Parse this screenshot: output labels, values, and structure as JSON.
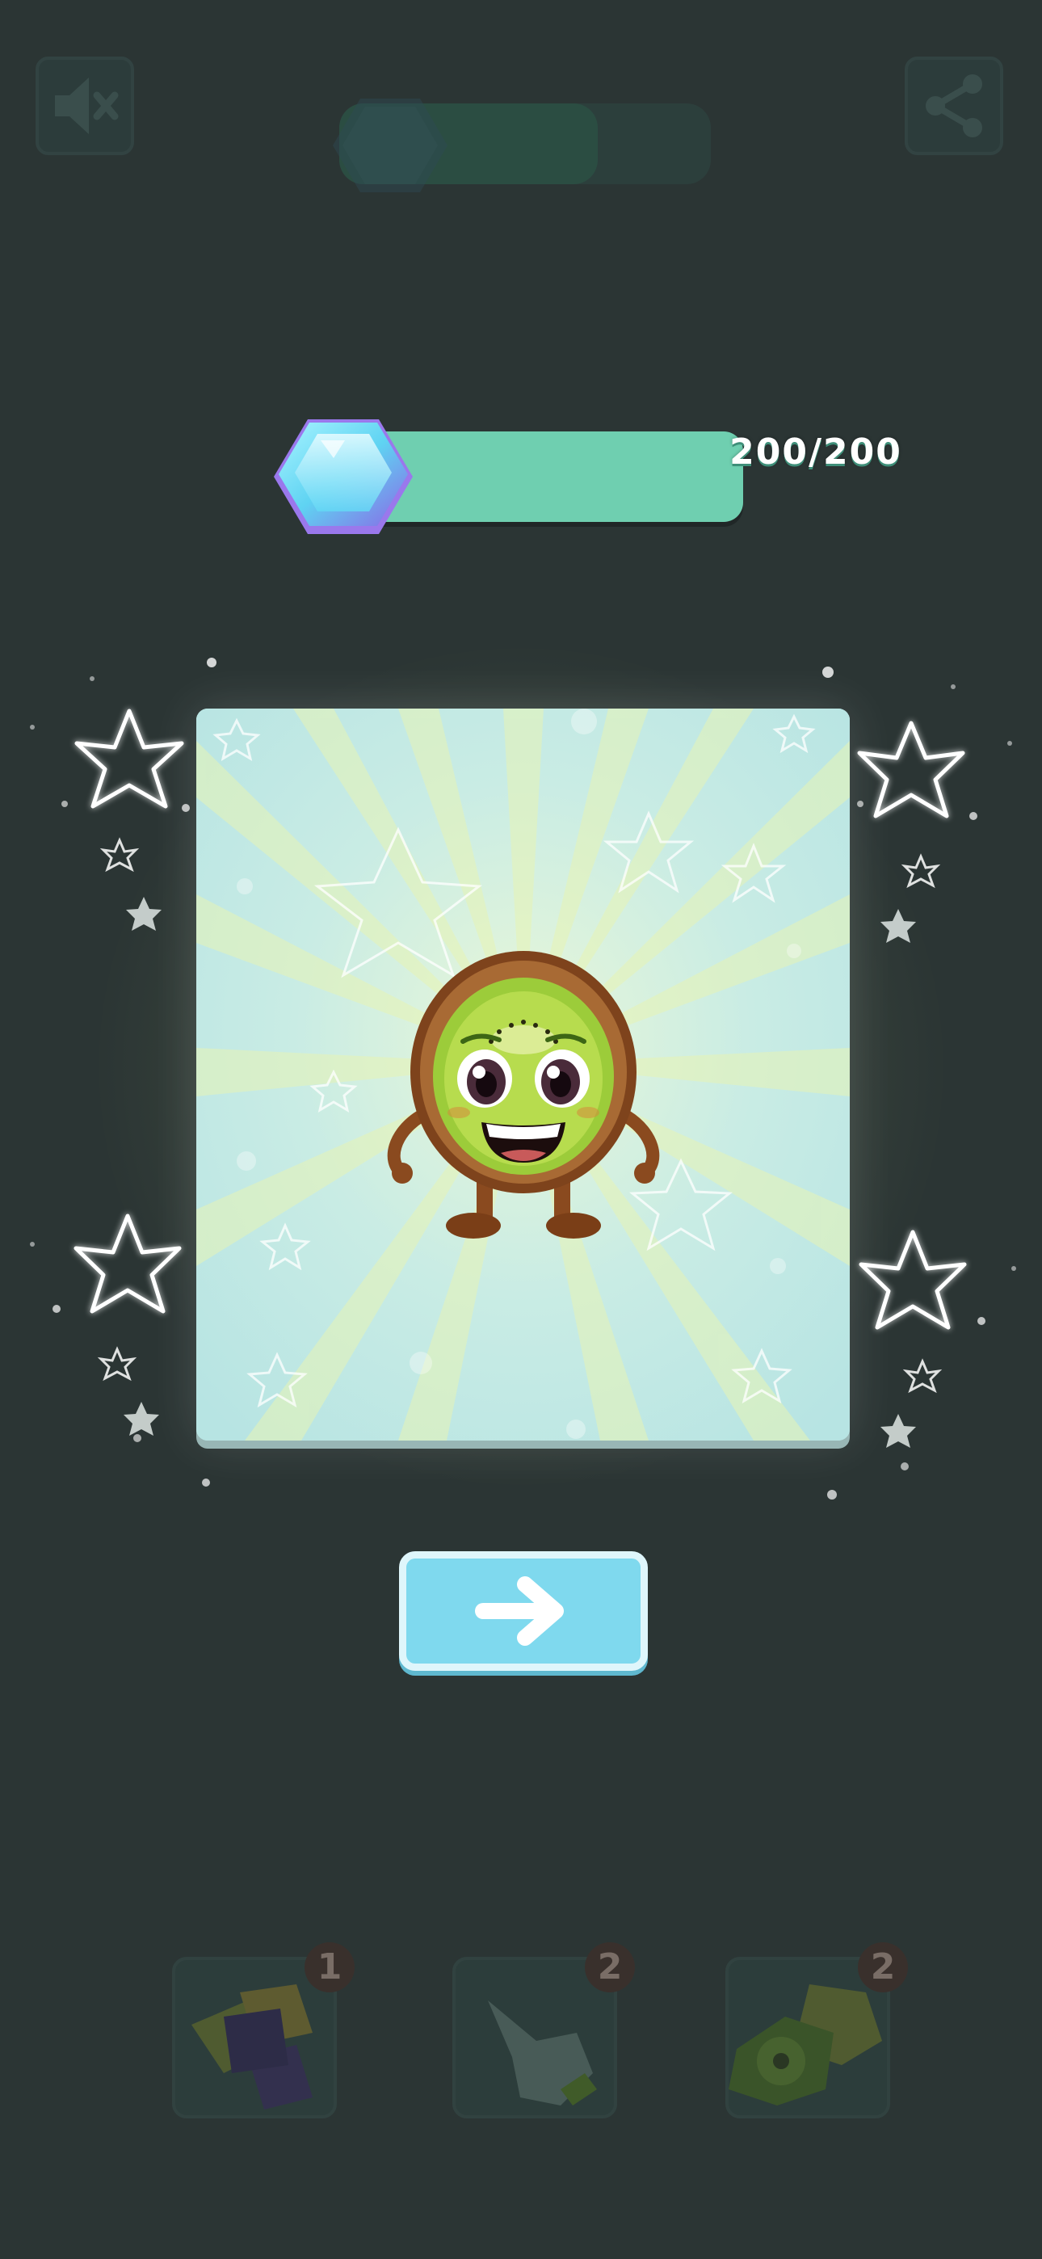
{
  "hud": {
    "mute_icon": "speaker-mute-icon",
    "share_icon": "share-icon"
  },
  "progress": {
    "label": "200/200",
    "current": 200,
    "max": 200,
    "gem_icon": "hexagon-gem-icon"
  },
  "reward": {
    "character": "kiwi-character"
  },
  "next_button": {
    "icon": "arrow-right-icon"
  },
  "boosters": [
    {
      "icon": "blocks-icon",
      "count": "1"
    },
    {
      "icon": "hand-pointer-icon",
      "count": "2"
    },
    {
      "icon": "kiwi-slice-icon",
      "count": "2"
    }
  ],
  "colors": {
    "background": "#2b3534",
    "progress_fill": "#6fcfb0",
    "card": "#bfe9e7",
    "button": "#7fd9ee"
  }
}
